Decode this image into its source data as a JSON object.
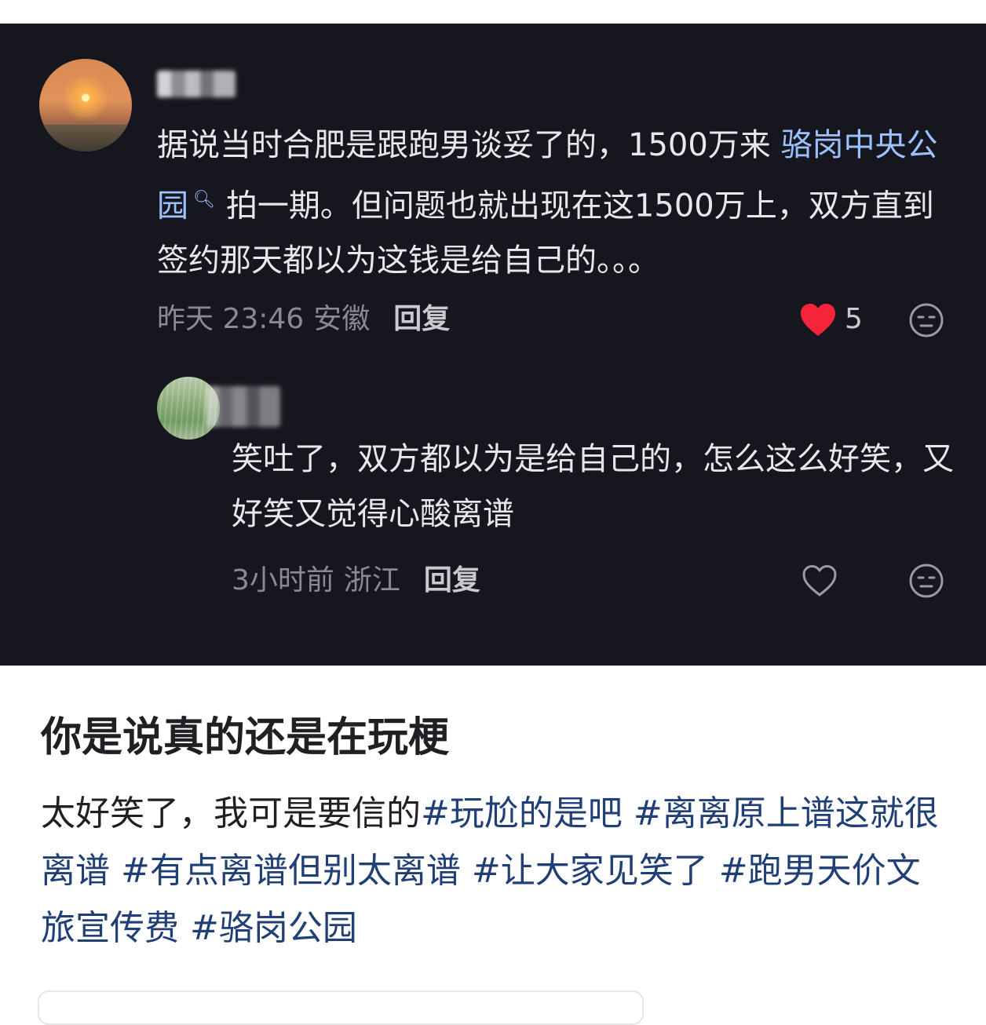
{
  "comment_main": {
    "text_before_link": "据说当时合肥是跟跑男谈妥了的，1500万来 ",
    "link_text": "骆岗中央公园",
    "text_after_link": "拍一期。但问题也就出现在这1500万上，双方直到签约那天都以为这钱是给自己的。。。",
    "time": "昨天 23:46",
    "location": "安徽",
    "reply_label": "回复",
    "like_count": "5",
    "liked": true
  },
  "comment_reply": {
    "text": "笑吐了，双方都以为是给自己的，怎么这么好笑，又好笑又觉得心酸离谱",
    "time": "3小时前",
    "location": "浙江",
    "reply_label": "回复",
    "liked": false
  },
  "post": {
    "title": "你是说真的还是在玩梗",
    "body_text": "太好笑了，我可是要信的",
    "tags": [
      "#玩尬的是吧",
      "#离离原上谱这就很离谱",
      "#有点离谱但别太离谱",
      "#让大家见笑了",
      "#跑男天价文旅宣传费",
      "#骆岗公园"
    ]
  },
  "icons": {
    "search": "search-icon",
    "like": "heart-icon",
    "dislike": "expressionless-face-icon"
  },
  "colors": {
    "dark_background": "#16161e",
    "link": "#9cc1ff",
    "heart_red": "#f5243b",
    "tag_blue": "#1f3f76"
  }
}
